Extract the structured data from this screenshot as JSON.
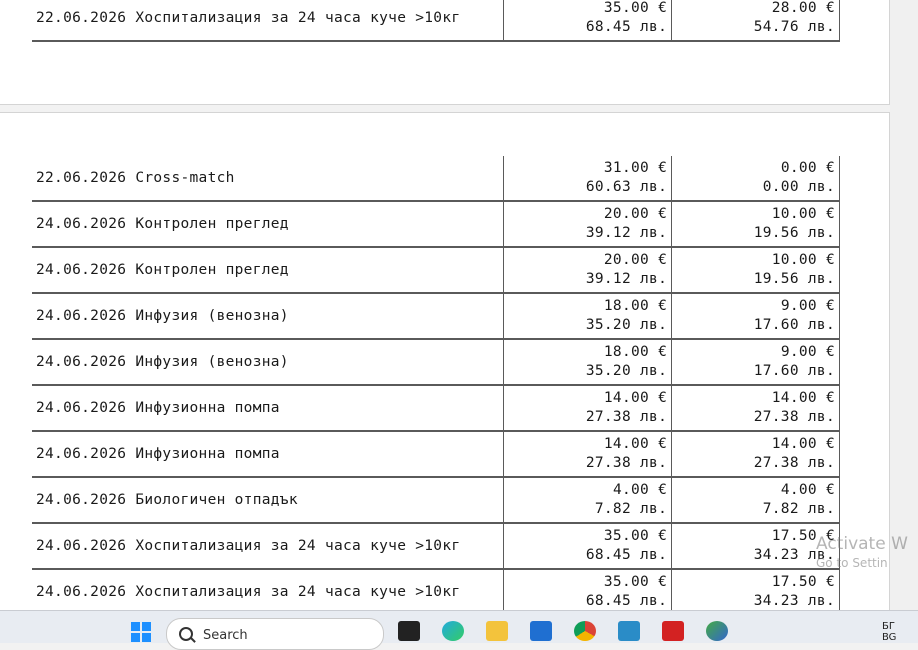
{
  "invoice_top": [
    {
      "desc": "22.06.2026 Хоспитализация за 24 часа куче >10кг",
      "price_eur": "35.00 €",
      "price_bgn": "68.45 лв.",
      "due_eur": "28.00 €",
      "due_bgn": "54.76 лв."
    }
  ],
  "invoice_bottom": [
    {
      "desc": "22.06.2026 Cross-match",
      "price_eur": "31.00 €",
      "price_bgn": "60.63 лв.",
      "due_eur": "0.00 €",
      "due_bgn": "0.00 лв."
    },
    {
      "desc": "24.06.2026 Контролен преглед",
      "price_eur": "20.00 €",
      "price_bgn": "39.12 лв.",
      "due_eur": "10.00 €",
      "due_bgn": "19.56 лв."
    },
    {
      "desc": "24.06.2026 Контролен преглед",
      "price_eur": "20.00 €",
      "price_bgn": "39.12 лв.",
      "due_eur": "10.00 €",
      "due_bgn": "19.56 лв."
    },
    {
      "desc": "24.06.2026 Инфузия (венозна)",
      "price_eur": "18.00 €",
      "price_bgn": "35.20 лв.",
      "due_eur": "9.00 €",
      "due_bgn": "17.60 лв."
    },
    {
      "desc": "24.06.2026 Инфузия (венозна)",
      "price_eur": "18.00 €",
      "price_bgn": "35.20 лв.",
      "due_eur": "9.00 €",
      "due_bgn": "17.60 лв."
    },
    {
      "desc": "24.06.2026 Инфузионна помпа",
      "price_eur": "14.00 €",
      "price_bgn": "27.38 лв.",
      "due_eur": "14.00 €",
      "due_bgn": "27.38 лв."
    },
    {
      "desc": "24.06.2026 Инфузионна помпа",
      "price_eur": "14.00 €",
      "price_bgn": "27.38 лв.",
      "due_eur": "14.00 €",
      "due_bgn": "27.38 лв."
    },
    {
      "desc": "24.06.2026 Биологичен отпадък",
      "price_eur": "4.00 €",
      "price_bgn": "7.82 лв.",
      "due_eur": "4.00 €",
      "due_bgn": "7.82 лв."
    },
    {
      "desc": "24.06.2026 Хоспитализация за 24 часа куче >10кг",
      "price_eur": "35.00 €",
      "price_bgn": "68.45 лв.",
      "due_eur": "17.50 €",
      "due_bgn": "34.23 лв."
    },
    {
      "desc": "24.06.2026 Хоспитализация за 24 часа куче >10кг",
      "price_eur": "35.00 €",
      "price_bgn": "68.45 лв.",
      "due_eur": "17.50 €",
      "due_bgn": "34.23 лв."
    }
  ],
  "watermark": {
    "line1": "Activate W",
    "line2": "Go to Settin"
  },
  "taskbar": {
    "search_label": "Search",
    "lang_line1": "БГ",
    "lang_line2": "BG"
  }
}
